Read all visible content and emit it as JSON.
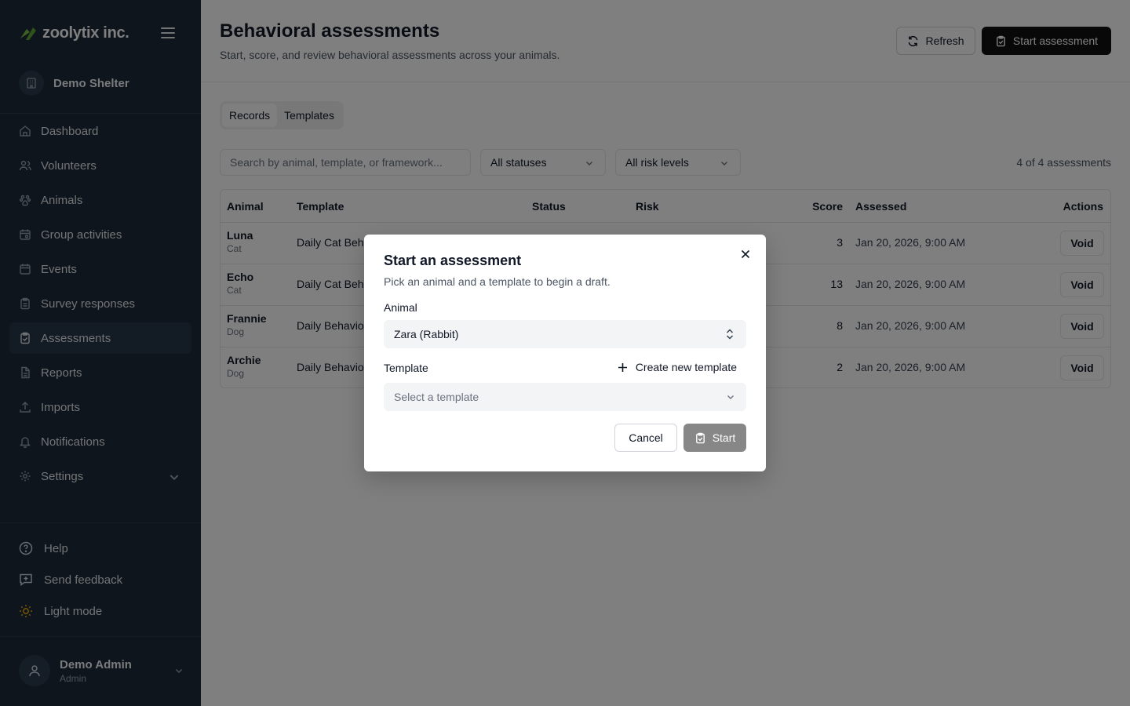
{
  "sidebar": {
    "brand": "zoolytix inc.",
    "org_name": "Demo Shelter",
    "nav": [
      {
        "label": "Dashboard",
        "icon": "home-icon"
      },
      {
        "label": "Volunteers",
        "icon": "users-icon"
      },
      {
        "label": "Animals",
        "icon": "paw-icon"
      },
      {
        "label": "Group activities",
        "icon": "calendar-group-icon"
      },
      {
        "label": "Events",
        "icon": "calendar-icon"
      },
      {
        "label": "Survey responses",
        "icon": "clipboard-icon"
      },
      {
        "label": "Assessments",
        "icon": "clipboard-check-icon",
        "active": true
      },
      {
        "label": "Reports",
        "icon": "file-icon"
      },
      {
        "label": "Imports",
        "icon": "upload-icon"
      },
      {
        "label": "Notifications",
        "icon": "bell-icon"
      },
      {
        "label": "Settings",
        "icon": "gear-icon"
      }
    ],
    "help": "Help",
    "feedback": "Send feedback",
    "theme": "Light mode",
    "user": {
      "name": "Demo Admin",
      "role": "Admin"
    }
  },
  "header": {
    "title": "Behavioral assessments",
    "subtitle": "Start, score, and review behavioral assessments across your animals.",
    "refresh_label": "Refresh",
    "start_label": "Start assessment"
  },
  "tabs": [
    "Records",
    "Templates"
  ],
  "filters": {
    "search_placeholder": "Search by animal, template, or framework...",
    "status": "All statuses",
    "risk": "All risk levels",
    "count": "4 of 4 assessments"
  },
  "table": {
    "columns": [
      "Animal",
      "Template",
      "Status",
      "Risk",
      "Score",
      "Assessed",
      "Actions"
    ],
    "rows": [
      {
        "animal": "Luna",
        "species": "Cat",
        "template": "Daily Cat Beh",
        "score": "3",
        "assessed": "Jan 20, 2026, 9:00 AM",
        "action": "Void"
      },
      {
        "animal": "Echo",
        "species": "Cat",
        "template": "Daily Cat Beh",
        "score": "13",
        "assessed": "Jan 20, 2026, 9:00 AM",
        "action": "Void"
      },
      {
        "animal": "Frannie",
        "species": "Dog",
        "template": "Daily Behavio",
        "score": "8",
        "assessed": "Jan 20, 2026, 9:00 AM",
        "action": "Void"
      },
      {
        "animal": "Archie",
        "species": "Dog",
        "template": "Daily Behavio",
        "score": "2",
        "assessed": "Jan 20, 2026, 9:00 AM",
        "action": "Void"
      }
    ]
  },
  "modal": {
    "title": "Start an assessment",
    "description": "Pick an animal and a template to begin a draft.",
    "animal_label": "Animal",
    "animal_value": "Zara (Rabbit)",
    "template_label": "Template",
    "create_template": "Create new template",
    "template_placeholder": "Select a template",
    "cancel_label": "Cancel",
    "start_label": "Start"
  },
  "colors": {
    "sidebar_bg": "#1c2a3a",
    "brand_green": "#7cc242",
    "primary": "#111111",
    "sun_yellow": "#f5b000"
  }
}
